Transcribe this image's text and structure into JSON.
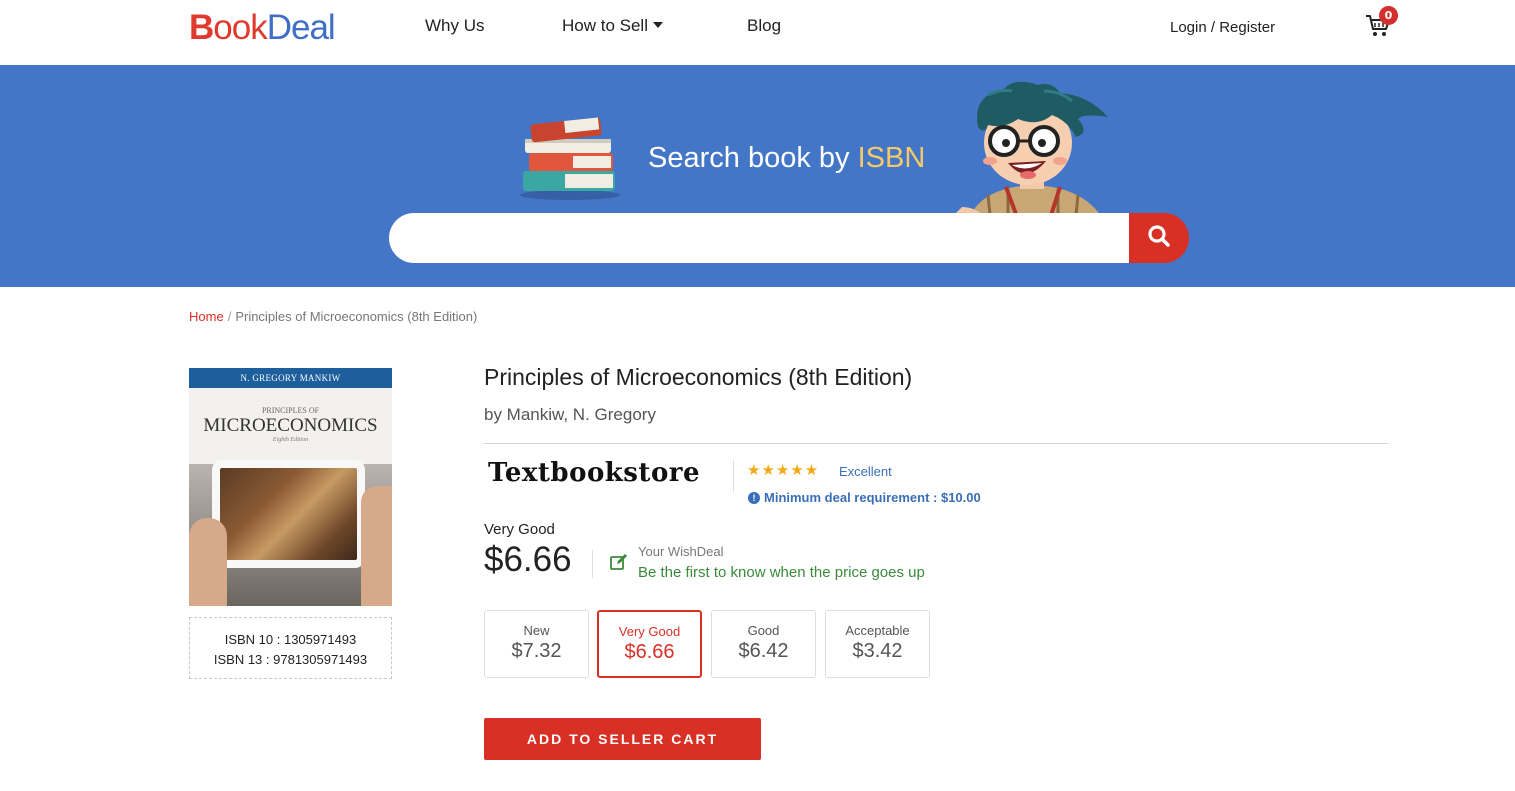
{
  "header": {
    "logo": {
      "b": "B",
      "ook": "ook",
      "deal": "Deal"
    },
    "nav": {
      "why_us": "Why Us",
      "how_to_sell": "How to Sell",
      "blog": "Blog"
    },
    "login_register": "Login / Register",
    "cart_count": "0"
  },
  "hero": {
    "title_prefix": "Search book by ",
    "title_highlight": "ISBN",
    "search_placeholder": "",
    "colors": {
      "background": "#4376c6",
      "highlight": "#f6c86a",
      "button": "#d93025"
    }
  },
  "breadcrumb": {
    "home": "Home",
    "separator": "/",
    "current": "Principles of Microeconomics (8th Edition)"
  },
  "book": {
    "cover": {
      "author_band": "N. GREGORY MANKIW",
      "subtitle": "PRINCIPLES OF",
      "title": "MICROECONOMICS",
      "edition": "Eighth Edition"
    },
    "isbn10": "ISBN 10 : 1305971493",
    "isbn13": "ISBN 13 : 9781305971493",
    "title": "Principles of Microeconomics (8th Edition)",
    "author": "by Mankiw, N. Gregory"
  },
  "seller": {
    "name": "Textbookstore",
    "stars": "★★★★★",
    "rating_label": "Excellent",
    "min_deal": "Minimum deal requirement : $10.00"
  },
  "selection": {
    "condition": "Very Good",
    "price": "$6.66",
    "wish_title": "Your WishDeal",
    "wish_sub": "Be the first to know when the price goes up"
  },
  "conditions": [
    {
      "name": "New",
      "price": "$7.32"
    },
    {
      "name": "Very Good",
      "price": "$6.66"
    },
    {
      "name": "Good",
      "price": "$6.42"
    },
    {
      "name": "Acceptable",
      "price": "$3.42"
    }
  ],
  "add_to_cart_label": "ADD TO SELLER CART"
}
